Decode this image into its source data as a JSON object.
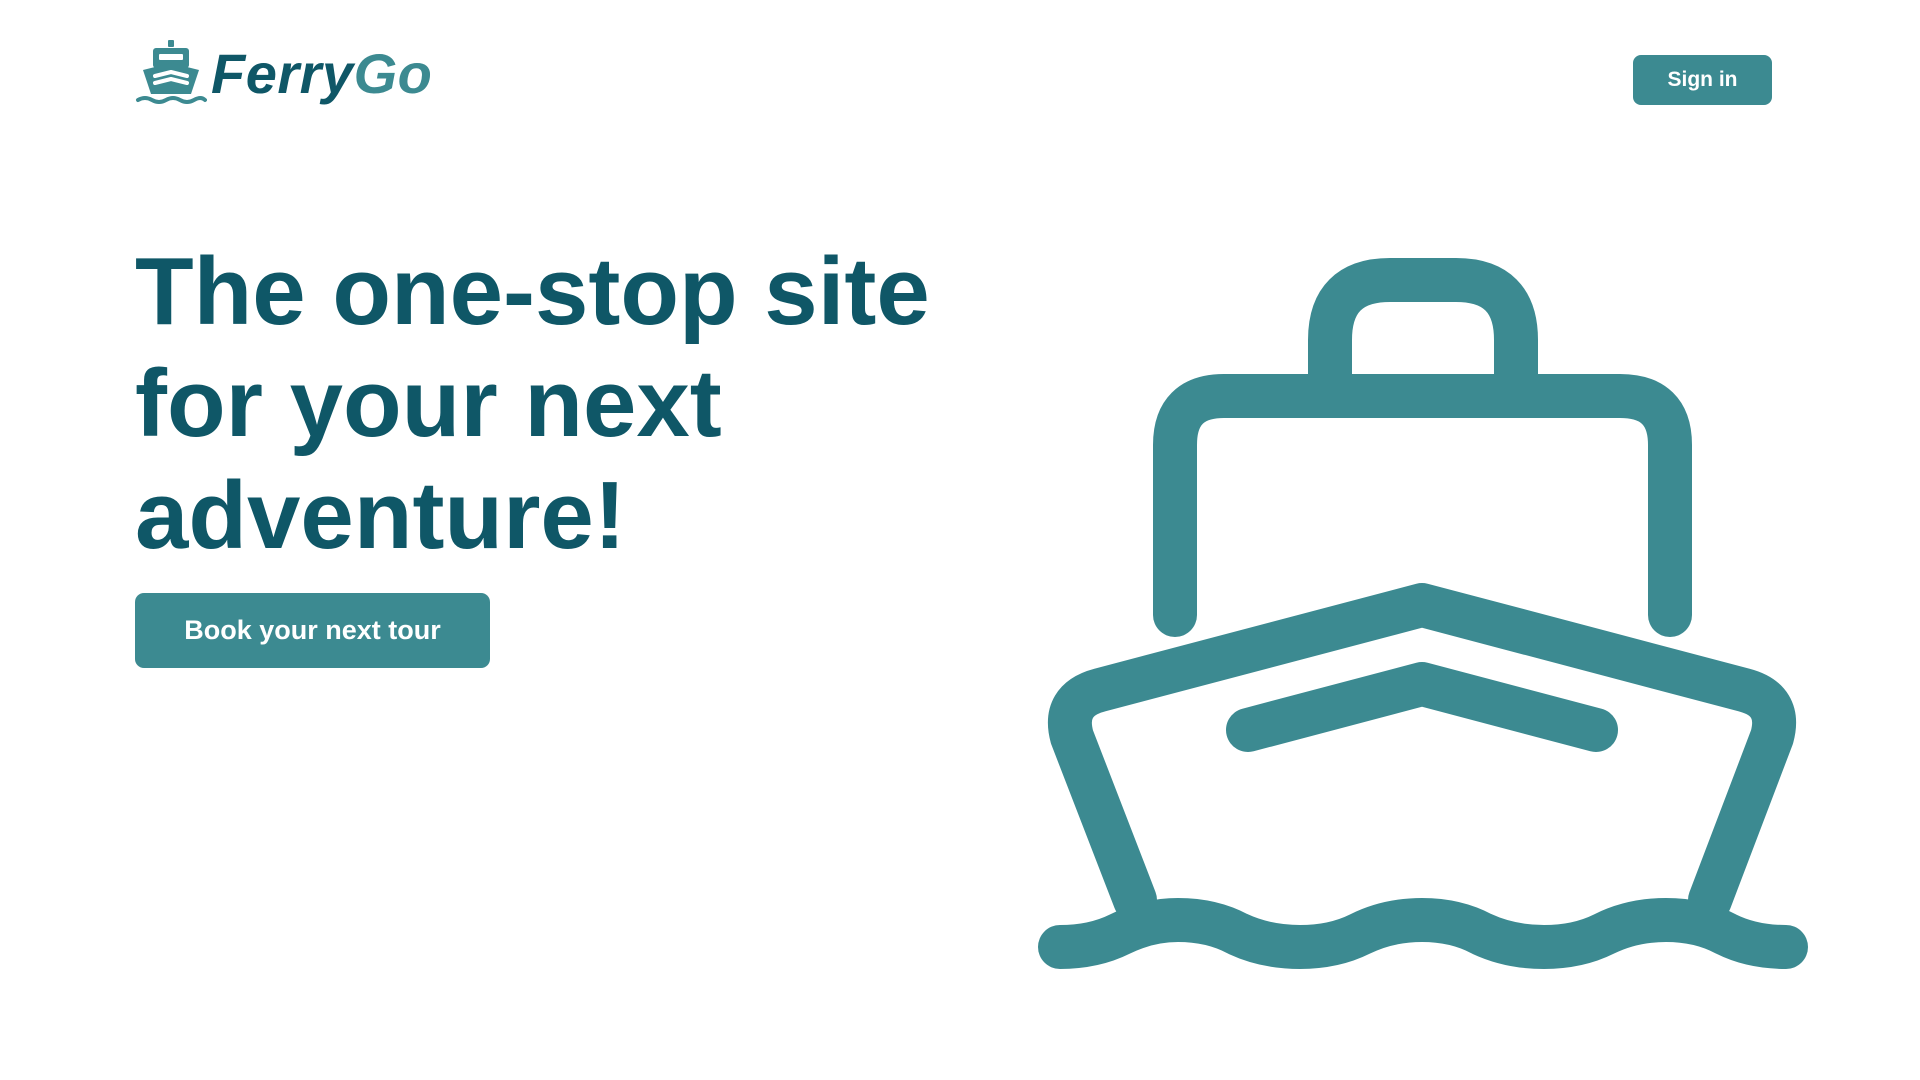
{
  "colors": {
    "primary_dark": "#0f5767",
    "accent": "#3c8a91",
    "background": "#ffffff",
    "button_text": "#ffffff"
  },
  "header": {
    "logo": {
      "icon": "ferry-icon",
      "name_part1": "Ferry",
      "name_part2": "Go"
    },
    "signin_label": "Sign in"
  },
  "hero": {
    "headline": "The one-stop site for your next adventure!",
    "cta_label": "Book your next tour",
    "illustration_icon": "ferry-icon"
  }
}
